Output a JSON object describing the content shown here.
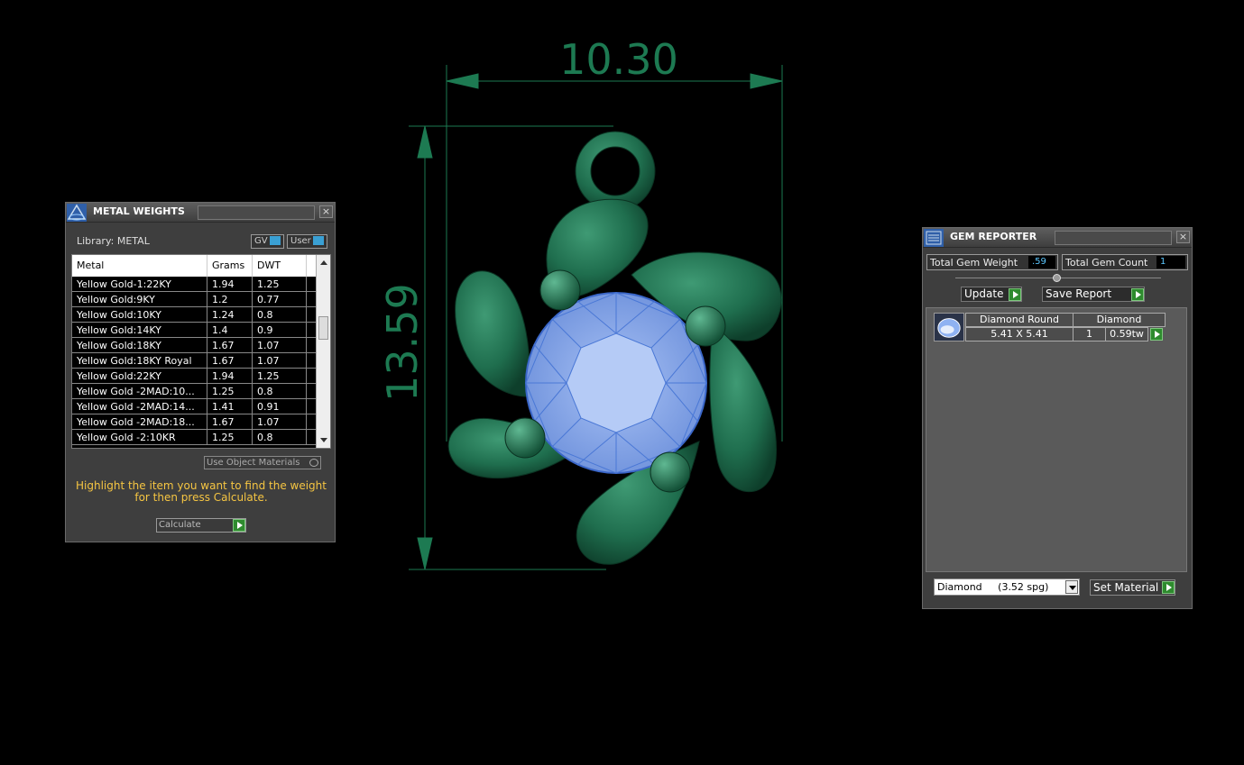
{
  "metal_weights": {
    "title": "METAL WEIGHTS",
    "close": "×",
    "library_label": "Library: METAL",
    "toggles": [
      "GV",
      "User"
    ],
    "columns": [
      "Metal",
      "Grams",
      "DWT"
    ],
    "rows": [
      [
        "Yellow Gold-1:22KY",
        "1.94",
        "1.25"
      ],
      [
        "Yellow Gold:9KY",
        "1.2",
        "0.77"
      ],
      [
        "Yellow Gold:10KY",
        "1.24",
        "0.8"
      ],
      [
        "Yellow Gold:14KY",
        "1.4",
        "0.9"
      ],
      [
        "Yellow Gold:18KY",
        "1.67",
        "1.07"
      ],
      [
        "Yellow Gold:18KY Royal",
        "1.67",
        "1.07"
      ],
      [
        "Yellow Gold:22KY",
        "1.94",
        "1.25"
      ],
      [
        "Yellow Gold -2MAD:10...",
        "1.25",
        "0.8"
      ],
      [
        "Yellow Gold -2MAD:14...",
        "1.41",
        "0.91"
      ],
      [
        "Yellow Gold -2MAD:18...",
        "1.67",
        "1.07"
      ],
      [
        "Yellow Gold -2:10KR",
        "1.25",
        "0.8"
      ]
    ],
    "use_object_materials": "Use Object Materials",
    "hint": "Highlight the item you want to find the weight for then press Calculate.",
    "calculate": "Calculate"
  },
  "gem_reporter": {
    "title": "GEM REPORTER",
    "close": "×",
    "total_weight_label": "Total Gem Weight",
    "total_weight_value": ".59",
    "total_count_label": "Total Gem Count",
    "total_count_value": "1",
    "update": "Update",
    "save_report": "Save Report",
    "gem": {
      "shape": "Diamond Round",
      "size": "5.41 X 5.41",
      "material": "Diamond",
      "count": "1",
      "weight": "0.59tw"
    },
    "material_select": "Diamond     (3.52 spg)",
    "set_material": "Set Material"
  },
  "viewport": {
    "width_dim": "10.30",
    "height_dim": "13.59"
  },
  "colors": {
    "metal_green": "#1f6e4e",
    "gem_blue": "#8fb2f2",
    "dimension": "#1d7a52",
    "hint_yellow": "#f5c542"
  }
}
